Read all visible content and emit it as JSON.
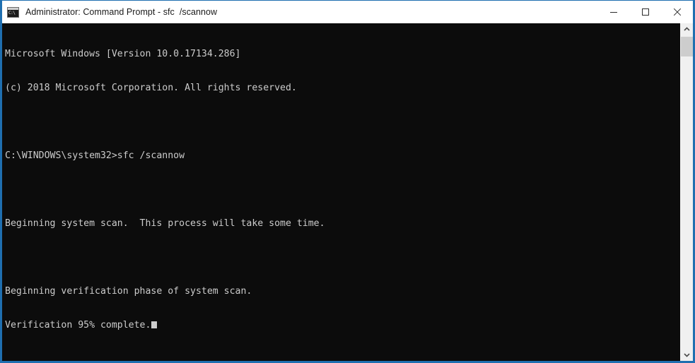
{
  "window": {
    "title": "Administrator: Command Prompt - sfc  /scannow",
    "icon": "command-prompt-icon",
    "icon_text": "C:\\",
    "border_color": "#1f6fb0",
    "titlebar_bg": "#ffffff",
    "console_bg": "#0c0c0c",
    "console_fg": "#cccccc",
    "controls": {
      "minimize_label": "Minimize",
      "maximize_label": "Maximize",
      "close_label": "Close"
    }
  },
  "console": {
    "lines": [
      "Microsoft Windows [Version 10.0.17134.286]",
      "(c) 2018 Microsoft Corporation. All rights reserved.",
      "",
      "C:\\WINDOWS\\system32>sfc /scannow",
      "",
      "Beginning system scan.  This process will take some time.",
      "",
      "Beginning verification phase of system scan."
    ],
    "last_line": "Verification 95% complete.",
    "progress_percent": "95%",
    "cursor": "block-cursor"
  },
  "scrollbar": {
    "up_arrow": "chevron-up-icon",
    "down_arrow": "chevron-down-icon",
    "thumb": "scrollbar-thumb",
    "track_color": "#f0f0f0",
    "thumb_color": "#cdcdcd"
  }
}
